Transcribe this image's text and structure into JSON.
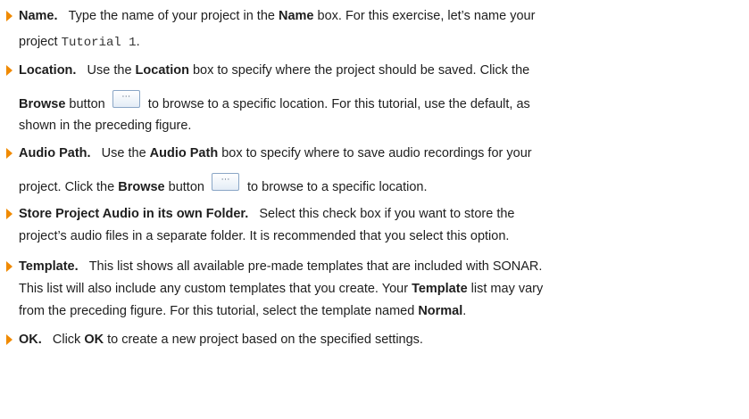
{
  "items": [
    {
      "title": "Name.",
      "lines": [
        [
          "Type the name of your project in the ",
          "Name",
          " box. For this exercise, let’s name your"
        ],
        [
          "project ",
          "Tutorial 1",
          "."
        ]
      ]
    },
    {
      "title": "Location.",
      "lines": [
        [
          "Use the ",
          "Location",
          " box to specify where the project should be saved. Click the"
        ],
        [
          "Browse",
          " button ",
          " to browse to a specific location. For this tutorial, use the default, as"
        ],
        [
          "shown in the preceding figure."
        ]
      ]
    },
    {
      "title": "Audio Path.",
      "lines": [
        [
          "Use the ",
          "Audio Path",
          " box to specify where to save audio recordings for your"
        ],
        [
          "project. Click the ",
          "Browse",
          " button ",
          " to browse to a specific location."
        ]
      ]
    },
    {
      "title": "Store Project Audio in its own Folder.",
      "lines": [
        [
          "Select this check box if you want to store the"
        ],
        [
          "project’s audio files in a separate folder. It is recommended that you select this option."
        ]
      ]
    },
    {
      "title": "Template.",
      "lines": [
        [
          "This list shows all available pre-made templates that are included with SONAR."
        ],
        [
          "This list will also include any custom templates that you create. Your ",
          "Template",
          " list may vary"
        ],
        [
          "from the preceding figure. For this tutorial, select the template named ",
          "Normal",
          "."
        ]
      ]
    },
    {
      "title": "OK.",
      "lines": [
        [
          "Click ",
          "OK",
          " to create a new project based on the specified settings."
        ]
      ]
    }
  ],
  "browse_button_glyph": "⋯",
  "colors": {
    "bullet": "#f08a00",
    "text": "#1e1e1e"
  }
}
